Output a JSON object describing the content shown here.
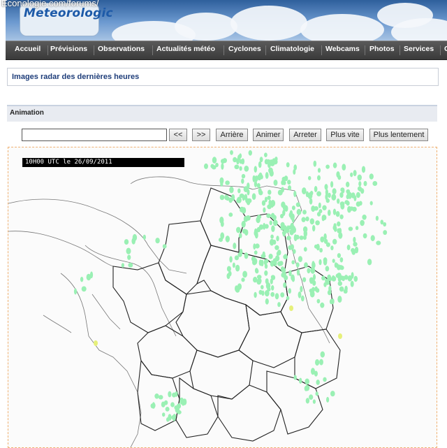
{
  "site": {
    "url_overlay": "Econologie.com/forums/",
    "logo_text": "Meteorologic",
    "colors": {
      "brand_blue": "#1d5aa8",
      "nav_bg": "#4a4a4a",
      "title_color": "#1f3e7a",
      "radar_echo": "#9af0b4",
      "radar_echo_strong": "#e6f07a"
    }
  },
  "nav": {
    "items": [
      "Accueil",
      "Prévisions",
      "Observations",
      "Actualités météo",
      "Cyclones",
      "Climatologie",
      "Webcams",
      "Photos",
      "Services",
      "C"
    ]
  },
  "page": {
    "title": "Images radar des dernières heures",
    "section_label": "Animation"
  },
  "controls": {
    "frame_value": "",
    "buttons": [
      "<<",
      ">>",
      "Arrière",
      "Animer",
      "Arreter",
      "Plus vite",
      "Plus lentement"
    ]
  },
  "radar": {
    "timestamp": "10H00 UTC le 26/09/2011",
    "icons": {
      "map": "france-map-icon"
    }
  }
}
